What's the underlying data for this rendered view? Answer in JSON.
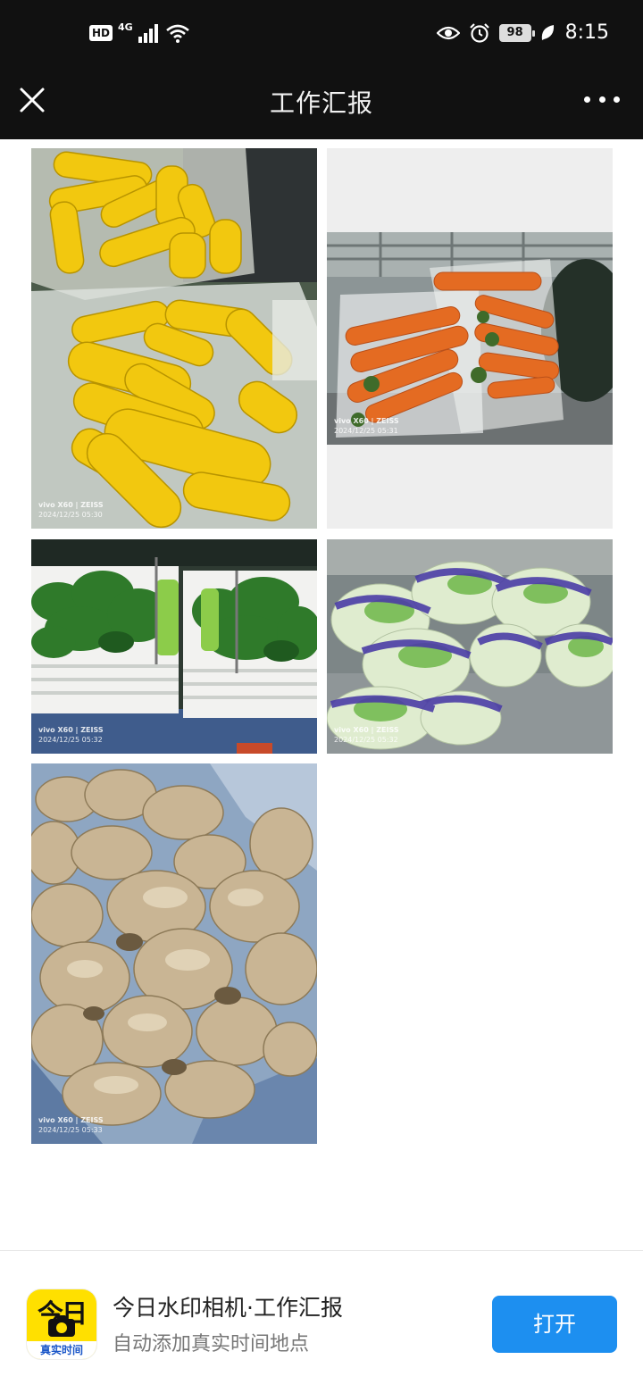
{
  "status_bar": {
    "hd_label": "HD",
    "network_label": "4G",
    "battery_level": "98",
    "time": "8:15"
  },
  "title_bar": {
    "title": "工作汇报"
  },
  "photos": [
    {
      "subject": "corn",
      "watermark_line1": "vivo X60 | ZEISS",
      "watermark_line2": "2024/12/25 05:30"
    },
    {
      "subject": "carrot",
      "watermark_line1": "vivo X60 | ZEISS",
      "watermark_line2": "2024/12/25 05:31"
    },
    {
      "subject": "spinach",
      "watermark_line1": "vivo X60 | ZEISS",
      "watermark_line2": "2024/12/25 05:32"
    },
    {
      "subject": "bok-choy",
      "watermark_line1": "vivo X60 | ZEISS",
      "watermark_line2": "2024/12/25 05:32"
    },
    {
      "subject": "ginger",
      "watermark_line1": "vivo X60 | ZEISS",
      "watermark_line2": "2024/12/25 05:33"
    }
  ],
  "app_banner": {
    "icon_big_text": "今日",
    "icon_strip_text": "真实时间",
    "app_name": "今日水印相机·工作汇报",
    "app_desc": "自动添加真实时间地点",
    "open_label": "打开"
  },
  "colors": {
    "header_bg": "#111111",
    "open_button": "#1d8ff0",
    "app_icon_yellow": "#ffe000"
  },
  "icons": [
    "close-icon",
    "more-icon",
    "eye-icon",
    "alarm-icon",
    "leaf-icon",
    "signal-icon",
    "wifi-icon",
    "camera-icon"
  ]
}
